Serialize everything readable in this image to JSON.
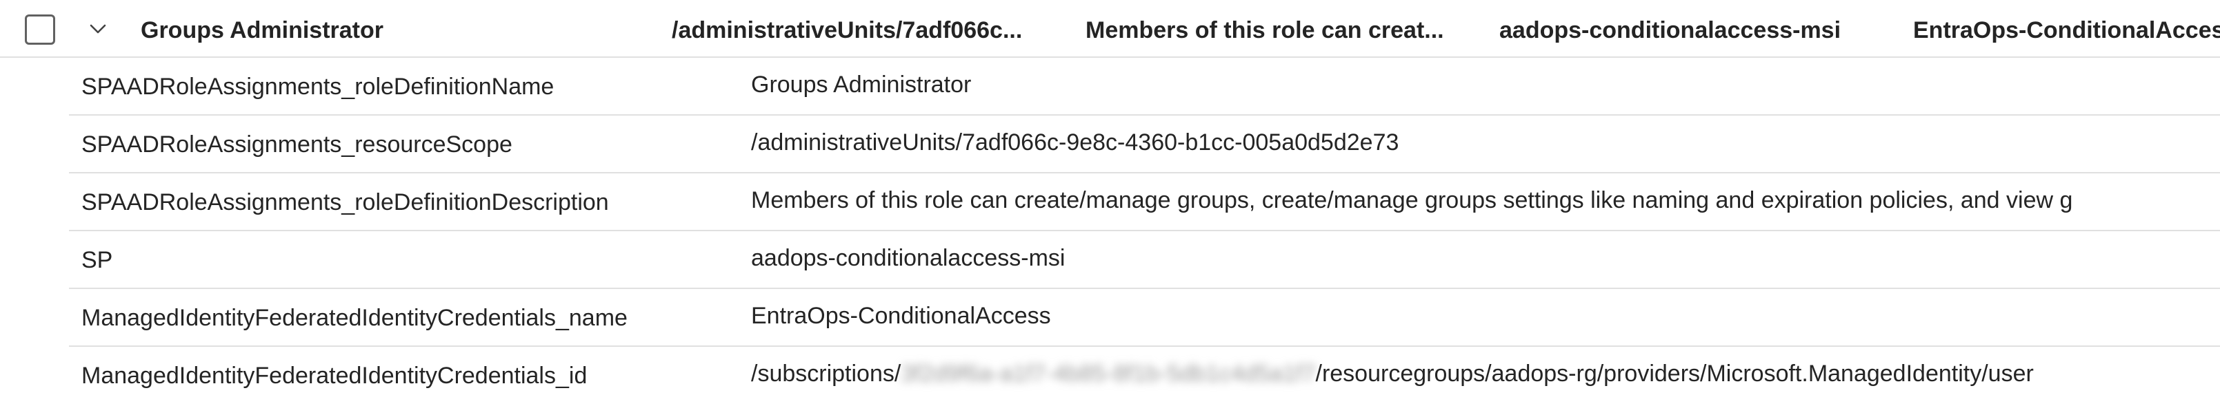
{
  "group": {
    "role_name": "Groups Administrator",
    "resource_scope": "/administrativeUnits/7adf066c...",
    "description": "Members of this role can creat...",
    "sp": "aadops-conditionalaccess-msi",
    "credential_name": "EntraOps-ConditionalAcces"
  },
  "details": [
    {
      "key": "SPAADRoleAssignments_roleDefinitionName",
      "value": "Groups Administrator"
    },
    {
      "key": "SPAADRoleAssignments_resourceScope",
      "value": "/administrativeUnits/7adf066c-9e8c-4360-b1cc-005a0d5d2e73"
    },
    {
      "key": "SPAADRoleAssignments_roleDefinitionDescription",
      "value": "Members of this role can create/manage groups, create/manage groups settings like naming and expiration policies, and view g"
    },
    {
      "key": "SP",
      "value": "aadops-conditionalaccess-msi"
    },
    {
      "key": "ManagedIdentityFederatedIdentityCredentials_name",
      "value": "EntraOps-ConditionalAccess"
    },
    {
      "key": "ManagedIdentityFederatedIdentityCredentials_id",
      "value_prefix": "/subscriptions/",
      "value_redacted": "3f2d9f6a-a1f7-4b85-8f1b-5db1c4d5a1f7",
      "value_suffix": "/resourcegroups/aadops-rg/providers/Microsoft.ManagedIdentity/user"
    }
  ]
}
